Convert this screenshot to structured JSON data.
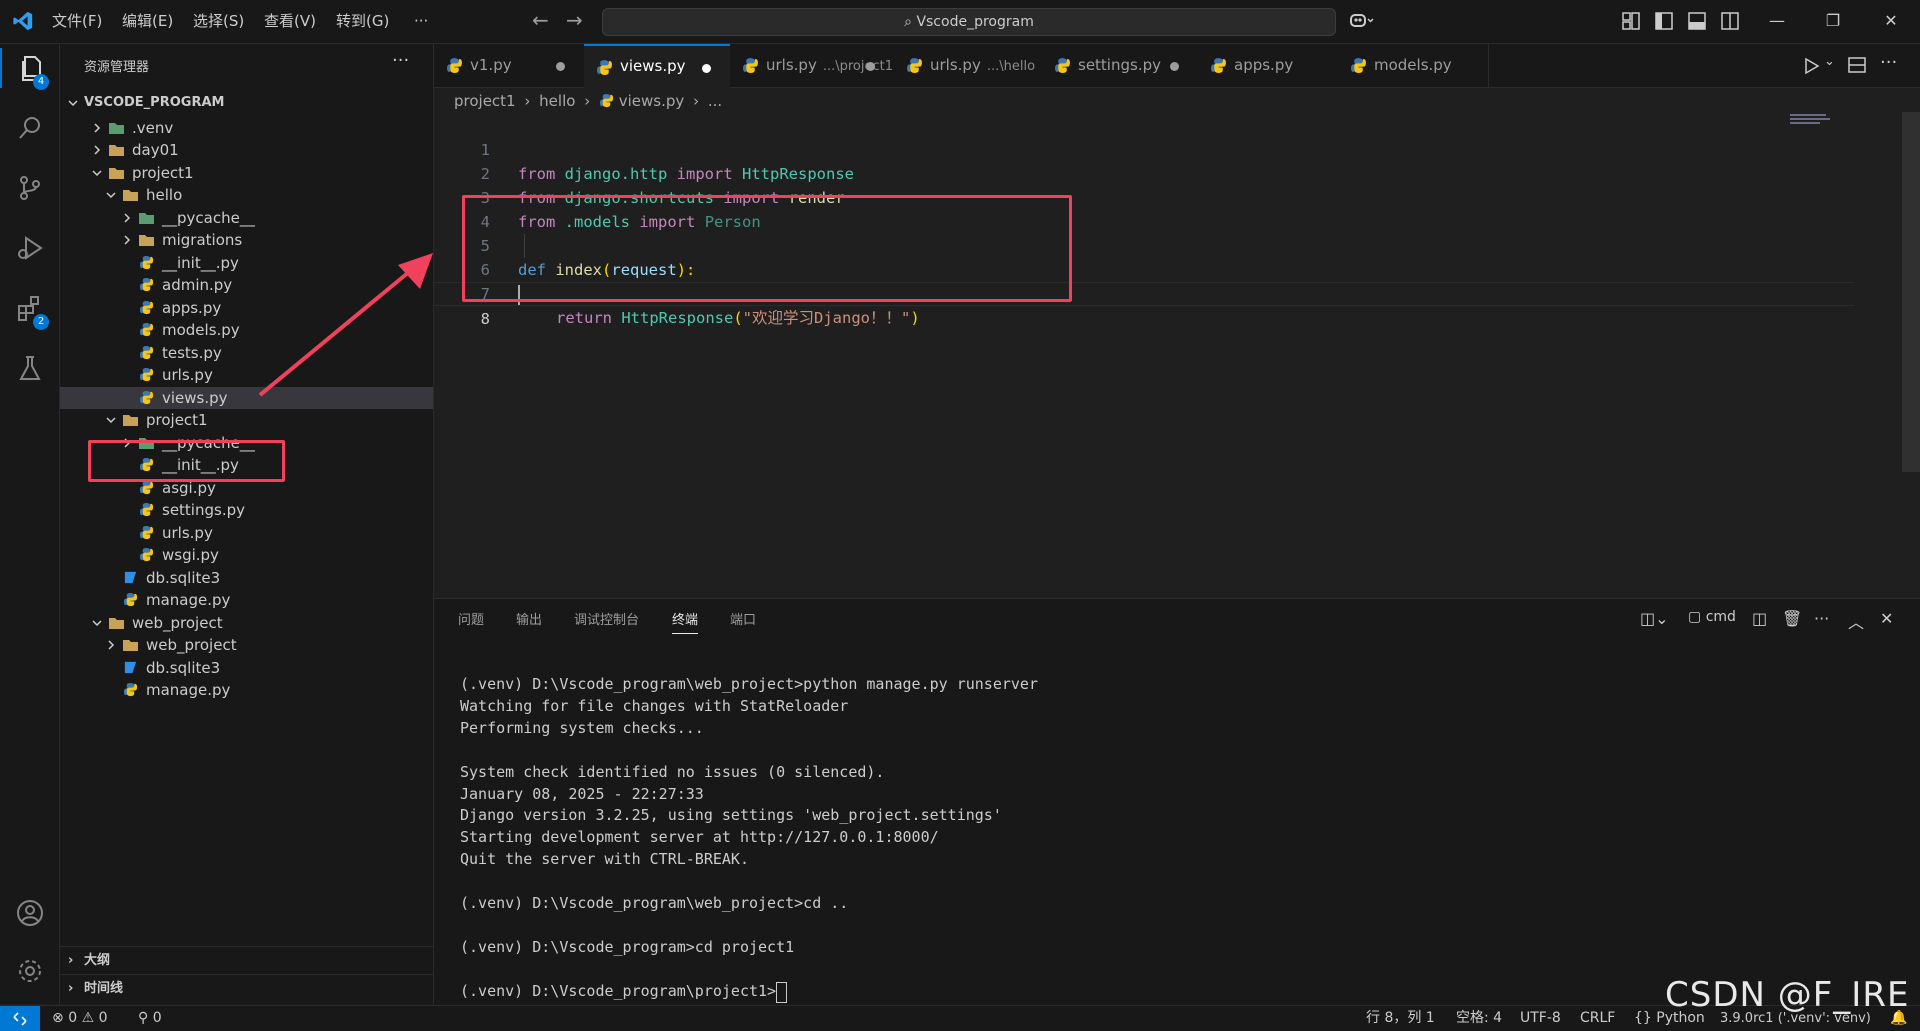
{
  "titlebar": {
    "menus": [
      "文件(F)",
      "编辑(E)",
      "选择(S)",
      "查看(V)",
      "转到(G)",
      "···"
    ],
    "search_text": "Vscode_program"
  },
  "activity": {
    "explorer_badge": "4",
    "extensions_badge": "2"
  },
  "sidebar": {
    "title": "资源管理器",
    "more": "···",
    "root": "VSCODE_PROGRAM",
    "outline": "大纲",
    "timeline": "时间线",
    "tree": [
      {
        "label": ".venv",
        "type": "folder-special",
        "depth": 1,
        "expanded": false
      },
      {
        "label": "day01",
        "type": "folder",
        "depth": 1,
        "expanded": false
      },
      {
        "label": "project1",
        "type": "folder",
        "depth": 1,
        "expanded": true
      },
      {
        "label": "hello",
        "type": "folder",
        "depth": 2,
        "expanded": true
      },
      {
        "label": "__pycache__",
        "type": "folder-special",
        "depth": 3,
        "expanded": false
      },
      {
        "label": "migrations",
        "type": "folder",
        "depth": 3,
        "expanded": false
      },
      {
        "label": "__init__.py",
        "type": "python",
        "depth": 3
      },
      {
        "label": "admin.py",
        "type": "python",
        "depth": 3
      },
      {
        "label": "apps.py",
        "type": "python",
        "depth": 3
      },
      {
        "label": "models.py",
        "type": "python",
        "depth": 3
      },
      {
        "label": "tests.py",
        "type": "python",
        "depth": 3
      },
      {
        "label": "urls.py",
        "type": "python",
        "depth": 3
      },
      {
        "label": "views.py",
        "type": "python",
        "depth": 3,
        "selected": true
      },
      {
        "label": "project1",
        "type": "folder",
        "depth": 2,
        "expanded": true
      },
      {
        "label": "__pycache__",
        "type": "folder-special",
        "depth": 3,
        "expanded": false
      },
      {
        "label": "__init__.py",
        "type": "python",
        "depth": 3
      },
      {
        "label": "asgi.py",
        "type": "python",
        "depth": 3
      },
      {
        "label": "settings.py",
        "type": "python",
        "depth": 3
      },
      {
        "label": "urls.py",
        "type": "python",
        "depth": 3
      },
      {
        "label": "wsgi.py",
        "type": "python",
        "depth": 3
      },
      {
        "label": "db.sqlite3",
        "type": "db",
        "depth": 2
      },
      {
        "label": "manage.py",
        "type": "python",
        "depth": 2
      },
      {
        "label": "web_project",
        "type": "folder",
        "depth": 1,
        "expanded": true
      },
      {
        "label": "web_project",
        "type": "folder",
        "depth": 2,
        "expanded": false
      },
      {
        "label": "db.sqlite3",
        "type": "db",
        "depth": 2
      },
      {
        "label": "manage.py",
        "type": "python",
        "depth": 2
      }
    ]
  },
  "tabs": [
    {
      "label": "v1.py",
      "hint": "",
      "modified": true,
      "active": false
    },
    {
      "label": "views.py",
      "hint": "",
      "modified": true,
      "active": true
    },
    {
      "label": "urls.py",
      "hint": "...\\project1",
      "modified": true,
      "active": false
    },
    {
      "label": "urls.py",
      "hint": "...\\hello",
      "modified": false,
      "active": false
    },
    {
      "label": "settings.py",
      "hint": "",
      "modified": true,
      "active": false
    },
    {
      "label": "apps.py",
      "hint": "",
      "modified": false,
      "active": false
    },
    {
      "label": "models.py",
      "hint": "",
      "modified": false,
      "active": false
    }
  ],
  "breadcrumb": [
    "project1",
    "hello",
    "views.py",
    "..."
  ],
  "code": {
    "line_numbers": [
      "1",
      "2",
      "3",
      "4",
      "5",
      "6",
      "7",
      "8"
    ],
    "l1": {
      "from": "from",
      "mod": "django.http",
      "imp": "import",
      "name": "HttpResponse"
    },
    "l2": {
      "from": "from",
      "mod": "django.shortcuts",
      "imp": "import",
      "name": "render"
    },
    "l3": {
      "from": "from",
      "mod": ".models",
      "imp": "import",
      "name": "Person"
    },
    "l5": {
      "def": "def",
      "fn": "index",
      "open": "(",
      "param": "request",
      "close": "):"
    },
    "l6": {
      "ret": "return",
      "cls": "HttpResponse",
      "open": "(",
      "str": "\"欢迎学习Django！！\"",
      "close": ")"
    }
  },
  "panel": {
    "tabs": [
      "问题",
      "输出",
      "调试控制台",
      "终端",
      "端口"
    ],
    "active_tab": "终端",
    "shell": "cmd",
    "terminal_lines": [
      "(.venv) D:\\Vscode_program\\web_project>python manage.py runserver",
      "Watching for file changes with StatReloader",
      "Performing system checks...",
      "",
      "System check identified no issues (0 silenced).",
      "January 08, 2025 - 22:27:33",
      "Django version 3.2.25, using settings 'web_project.settings'",
      "Starting development server at http://127.0.0.1:8000/",
      "Quit the server with CTRL-BREAK.",
      "",
      "(.venv) D:\\Vscode_program\\web_project>cd ..",
      "",
      "(.venv) D:\\Vscode_program>cd project1",
      "",
      "(.venv) D:\\Vscode_program\\project1>"
    ]
  },
  "status": {
    "errors": "0",
    "warnings": "0",
    "ports": "0",
    "position": "行 8，列 1",
    "spaces": "空格: 4",
    "encoding": "UTF-8",
    "eol": "CRLF",
    "language": "Python",
    "interpreter": "3.9.0rc1 ('.venv': venv)"
  },
  "watermark": "CSDN @F_IRE",
  "colors": {
    "accent": "#0078d4",
    "annotation_red": "#f0415d",
    "python_blue": "#3b78b5",
    "python_yellow": "#f5c518"
  }
}
